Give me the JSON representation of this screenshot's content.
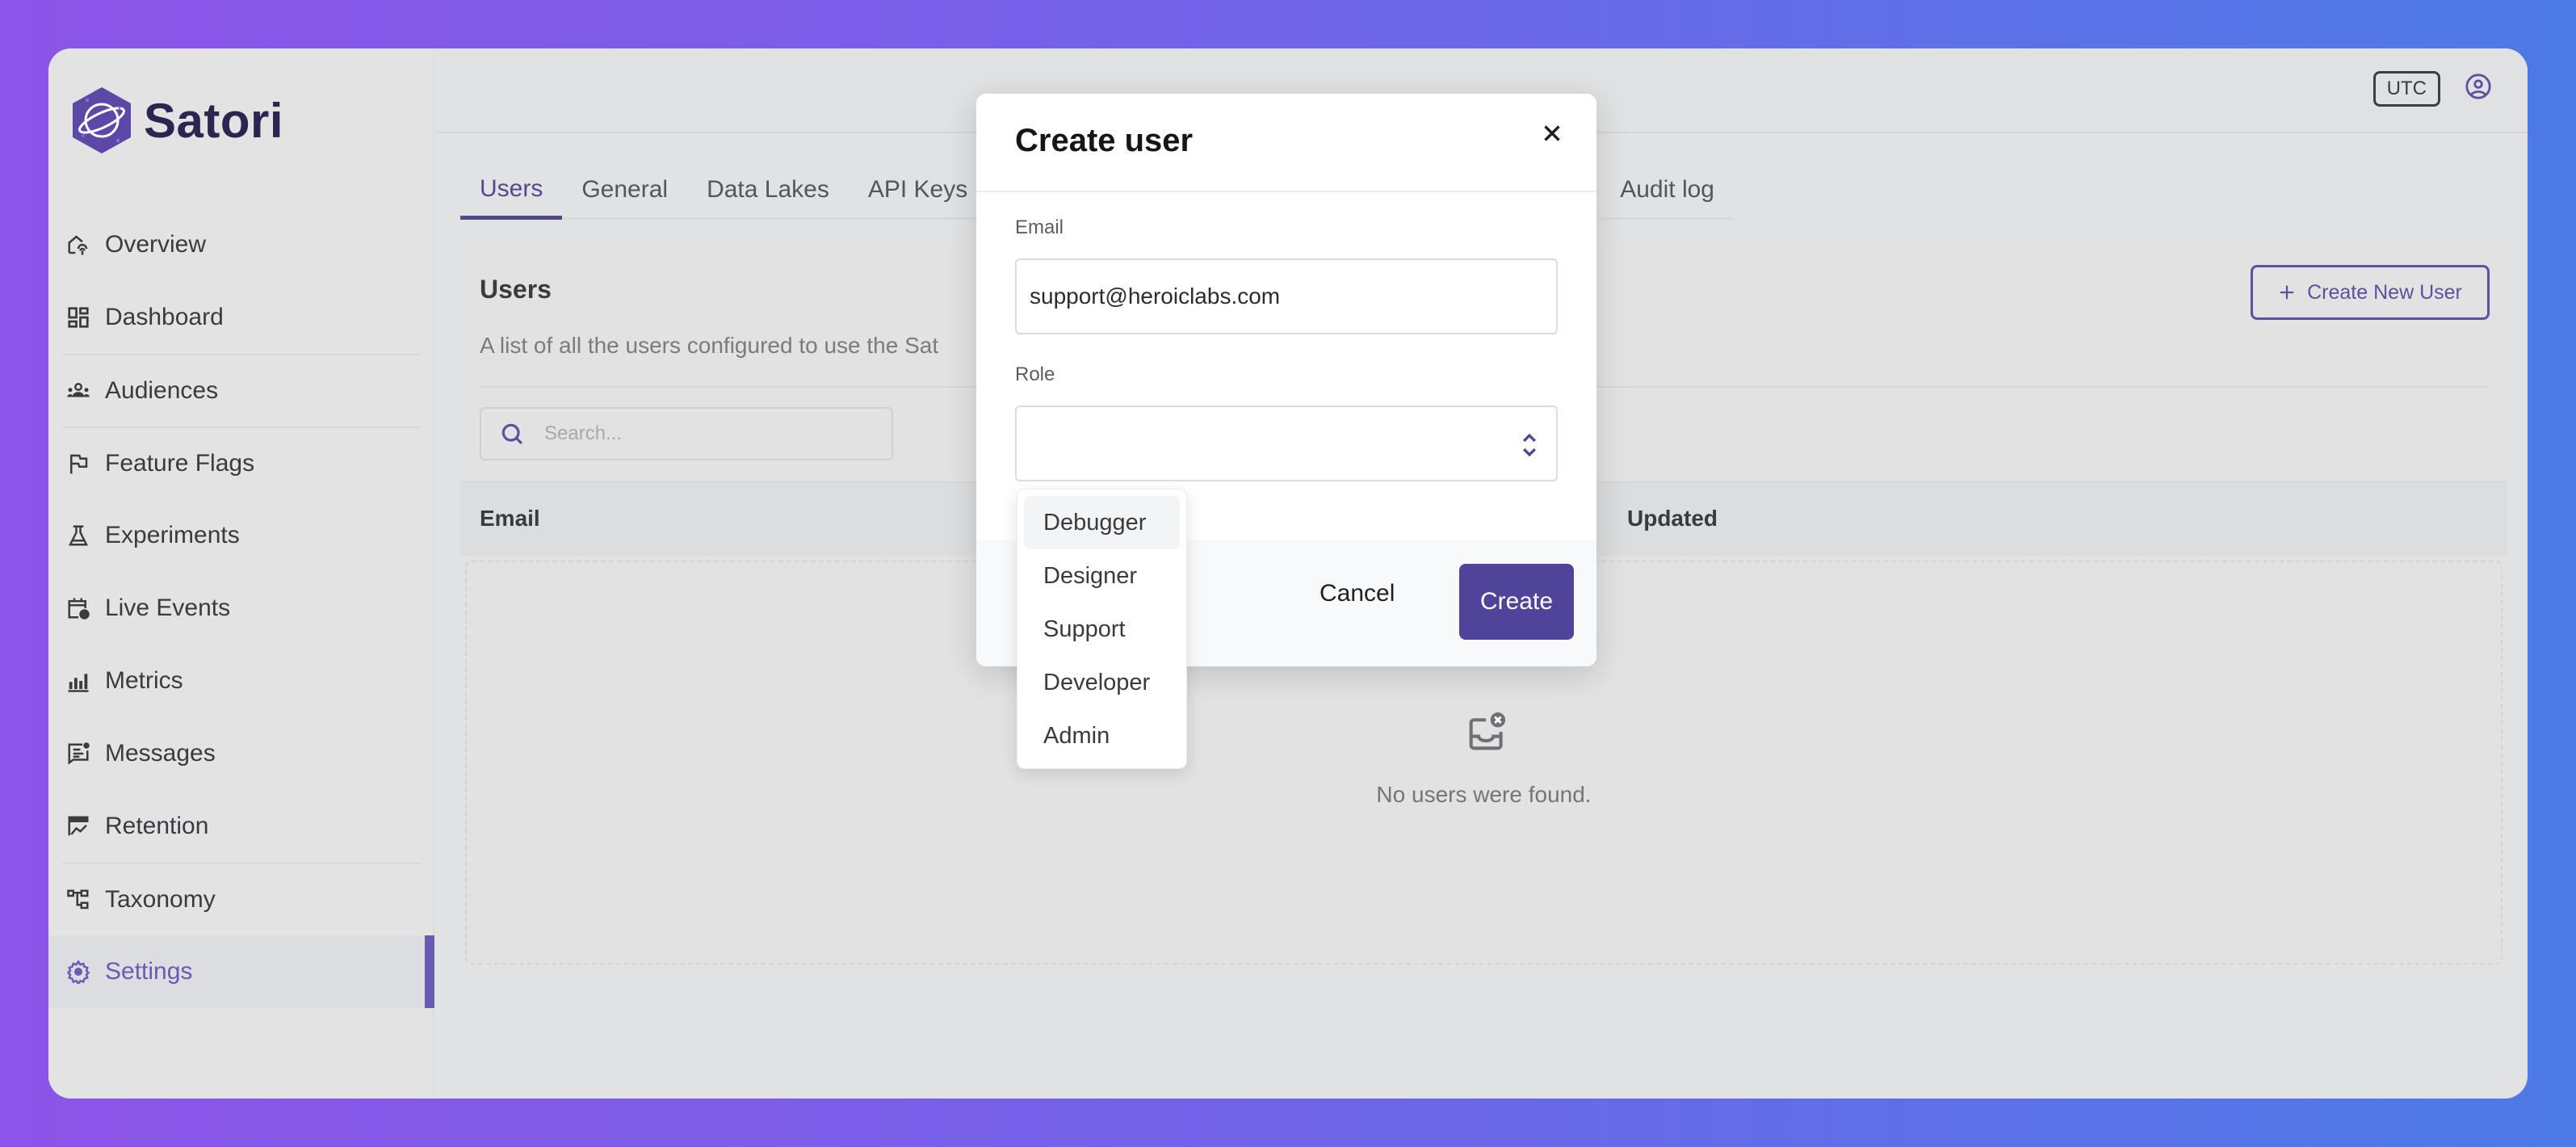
{
  "app": {
    "name": "Satori"
  },
  "colors": {
    "accent": "#51488f",
    "primary_button": "#4f449a",
    "active_nav": "#6a5bb2"
  },
  "sidebar": {
    "items": [
      {
        "label": "Overview",
        "icon": "house-signal-icon"
      },
      {
        "label": "Dashboard",
        "icon": "dashboard-icon"
      },
      {
        "label": "Audiences",
        "icon": "users-group-icon"
      },
      {
        "label": "Feature Flags",
        "icon": "flag-icon"
      },
      {
        "label": "Experiments",
        "icon": "flask-icon"
      },
      {
        "label": "Live Events",
        "icon": "calendar-clock-icon"
      },
      {
        "label": "Metrics",
        "icon": "bar-chart-icon"
      },
      {
        "label": "Messages",
        "icon": "message-icon"
      },
      {
        "label": "Retention",
        "icon": "retention-chart-icon"
      },
      {
        "label": "Taxonomy",
        "icon": "hierarchy-icon"
      },
      {
        "label": "Settings",
        "icon": "gear-icon",
        "active": true
      }
    ]
  },
  "topbar": {
    "timezone": "UTC",
    "user_icon": "user-circle-icon"
  },
  "tabs": [
    {
      "label": "Users",
      "active": true
    },
    {
      "label": "General"
    },
    {
      "label": "Data Lakes"
    },
    {
      "label": "API Keys"
    },
    {
      "label": "Audit log"
    }
  ],
  "users_card": {
    "title": "Users",
    "description": "A list of all the users configured to use the Sat",
    "create_button": "Create New User",
    "search_placeholder": "Search...",
    "columns": [
      "Email",
      "Updated"
    ],
    "empty_text": "No users were found."
  },
  "modal": {
    "title": "Create user",
    "email_label": "Email",
    "email_value": "support@heroiclabs.com",
    "role_label": "Role",
    "role_value": "",
    "cancel": "Cancel",
    "create": "Create"
  },
  "role_dropdown": {
    "options": [
      "Debugger",
      "Designer",
      "Support",
      "Developer",
      "Admin"
    ],
    "highlighted": "Debugger"
  }
}
